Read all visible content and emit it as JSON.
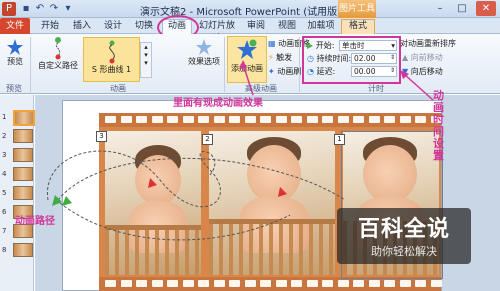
{
  "window": {
    "title": "演示文稿2 - Microsoft PowerPoint (试用版)",
    "contextual_tools_label": "图片工具",
    "logo_letter": "P"
  },
  "tabs": [
    {
      "label": "文件"
    },
    {
      "label": "开始"
    },
    {
      "label": "插入"
    },
    {
      "label": "设计"
    },
    {
      "label": "切换"
    },
    {
      "label": "动画"
    },
    {
      "label": "幻灯片放映"
    },
    {
      "label": "审阅"
    },
    {
      "label": "视图"
    },
    {
      "label": "加载项"
    },
    {
      "label": "格式"
    }
  ],
  "ribbon": {
    "preview": {
      "label": "预览",
      "group_label": "预览"
    },
    "animation_group": {
      "custom_path_label": "自定义路径",
      "s_curve_label": "S 形曲线 1",
      "effect_options_label": "效果选项",
      "group_label": "动画"
    },
    "advanced_group": {
      "add_animation_label": "添加动画",
      "animation_pane_label": "动画窗格",
      "trigger_label": "触发",
      "animation_painter_label": "动画刷",
      "group_label": "高级动画"
    },
    "timing_group": {
      "start_label": "开始:",
      "start_value": "单击时",
      "duration_label": "持续时间:",
      "duration_value": "02.00",
      "delay_label": "延迟:",
      "delay_value": "00.00",
      "reorder_label": "对动画重新排序",
      "move_earlier_label": "向前移动",
      "move_later_label": "向后移动",
      "group_label": "计时"
    }
  },
  "slides_pane": {
    "numbers": [
      "1",
      "2",
      "3",
      "4",
      "5",
      "6",
      "7",
      "8"
    ]
  },
  "slide": {
    "tag_left": "3",
    "tag_mid": "2",
    "tag_right": "1"
  },
  "annotations": {
    "effect_note": "里面有现成动画效果",
    "path_note": "动画路径",
    "timing_note": "动画时间设置"
  },
  "watermark": {
    "title": "百科全说",
    "subtitle": "助你轻松解决"
  },
  "colors": {
    "file_tab": "#d5472c",
    "annotation": "#d1369b",
    "film_strip": "#d9864b",
    "highlight": "#fbe49a"
  }
}
